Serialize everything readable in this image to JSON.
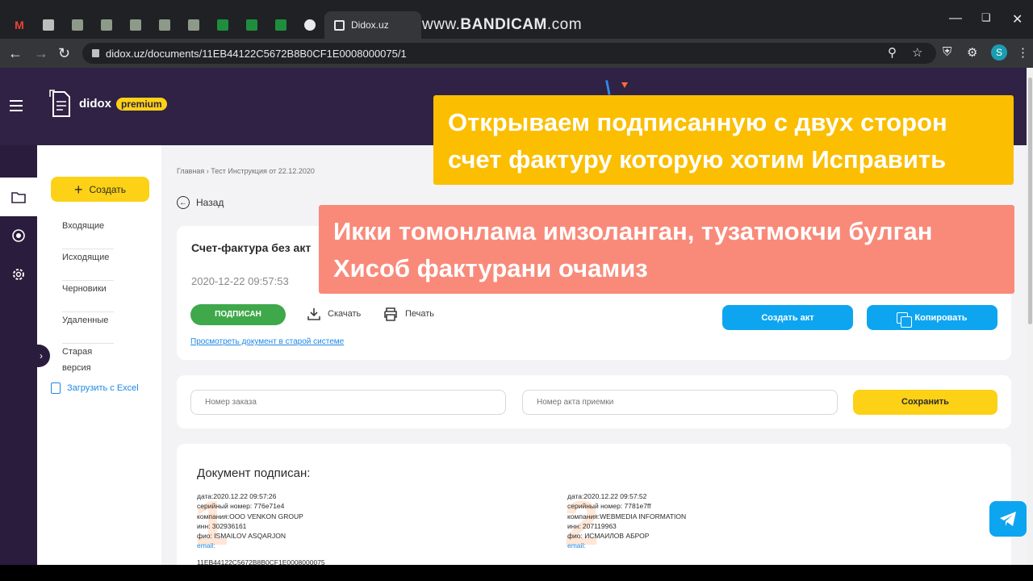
{
  "browser": {
    "pinned_tabs": [
      "M",
      "",
      "",
      "",
      "",
      "",
      "",
      "",
      "",
      ""
    ],
    "active_tab_title": "Didox.uz",
    "watermark_prefix": "www.",
    "watermark_brand": "BANDICAM",
    "watermark_suffix": ".com",
    "url": "didox.uz/documents/11EB44122C5672B8B0CF1E0008000075/1",
    "avatar_letter": "S"
  },
  "header": {
    "logo_text": "didox",
    "badge": "premium"
  },
  "sidebar": {
    "create_label": "Создать",
    "items": [
      "Входящие",
      "Исходящие",
      "Черновики",
      "Удаленные",
      "Старая версия"
    ],
    "excel_label": "Загрузить с Excel"
  },
  "breadcrumb": {
    "home": "Главная",
    "current": "Тест Инструкция от 22.12.2020"
  },
  "back_label": "Назад",
  "document": {
    "title": "Счет-фактура без акт",
    "date": "2020-12-22 09:57:53",
    "status": "ПОДПИСАН",
    "download_label": "Скачать",
    "print_label": "Печать",
    "old_system_link": "Просмотреть документ в старой системе",
    "create_act_label": "Создать акт",
    "copy_label": "Копировать"
  },
  "form": {
    "order_placeholder": "Номер заказа",
    "act_placeholder": "Номер акта приемки",
    "save_label": "Сохранить"
  },
  "signatures": {
    "title": "Документ подписан:",
    "signers": [
      {
        "number": "1",
        "date": "дата:2020.12.22 09:57:26",
        "serial": "серийный номер: 776e71e4",
        "company": "компания:OOO VENKON GROUP",
        "inn": "инн: 302936161",
        "fio": "фио: ISMAILOV ASQARJON",
        "email": "email:"
      },
      {
        "number": "2",
        "date": "дата:2020.12.22 09:57:52",
        "serial": "серийный номер: 7781e7ff",
        "company": "компания:WEBMEDIA INFORMATION",
        "inn": "инн: 207119963",
        "fio": "фио: ИСМАИЛОВ АБРОР",
        "email": "email:"
      }
    ],
    "doc_id": "11EB44122C5672B8B0CF1E0008000075"
  },
  "captions": {
    "ru_line1": "Открываем подписанную с двух сторон",
    "ru_line2": "счет фактуру которую хотим Исправить",
    "uz_line1": "Икки томонлама имзоланган, тузатмокчи булган",
    "uz_line2": "Хисоб фактурани очамиз"
  },
  "colors": {
    "accent_yellow": "#fcd116",
    "header_purple": "#302244",
    "button_blue": "#0ea5f0",
    "status_green": "#3fa84a"
  }
}
